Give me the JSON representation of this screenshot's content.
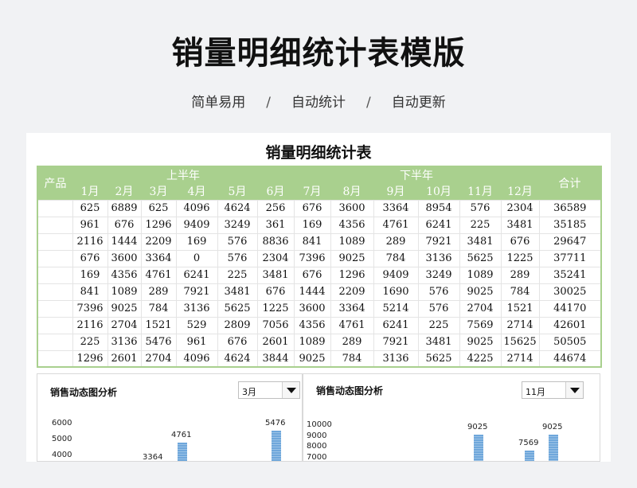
{
  "page": {
    "title": "销量明细统计表模版",
    "subtitle": [
      "简单易用",
      "自动统计",
      "自动更新"
    ],
    "separator": "/"
  },
  "sheet": {
    "title": "销量明细统计表",
    "header": {
      "product": "产品",
      "first_half": "上半年",
      "second_half": "下半年",
      "total": "合计",
      "months": [
        "1月",
        "2月",
        "3月",
        "4月",
        "5月",
        "6月",
        "7月",
        "8月",
        "9月",
        "10月",
        "11月",
        "12月"
      ]
    },
    "rows": [
      {
        "product": "",
        "values": [
          625,
          6889,
          625,
          4096,
          4624,
          256,
          676,
          3600,
          3364,
          8954,
          576,
          2304
        ],
        "total": 36589
      },
      {
        "product": "",
        "values": [
          961,
          676,
          1296,
          9409,
          3249,
          361,
          169,
          4356,
          4761,
          6241,
          225,
          3481
        ],
        "total": 35185
      },
      {
        "product": "",
        "values": [
          2116,
          1444,
          2209,
          169,
          576,
          8836,
          841,
          1089,
          289,
          7921,
          3481,
          676
        ],
        "total": 29647
      },
      {
        "product": "",
        "values": [
          676,
          3600,
          3364,
          0,
          576,
          2304,
          7396,
          9025,
          784,
          3136,
          5625,
          1225
        ],
        "total": 37711
      },
      {
        "product": "",
        "values": [
          169,
          4356,
          4761,
          6241,
          225,
          3481,
          676,
          1296,
          9409,
          3249,
          1089,
          289
        ],
        "total": 35241
      },
      {
        "product": "",
        "values": [
          841,
          1089,
          289,
          7921,
          3481,
          676,
          1444,
          2209,
          1690,
          576,
          9025,
          784
        ],
        "total": 30025
      },
      {
        "product": "",
        "values": [
          7396,
          9025,
          784,
          3136,
          5625,
          1225,
          3600,
          3364,
          5214,
          576,
          2704,
          1521
        ],
        "total": 44170
      },
      {
        "product": "",
        "values": [
          2116,
          2704,
          1521,
          529,
          2809,
          7056,
          4356,
          4761,
          6241,
          225,
          7569,
          2714
        ],
        "total": 42601
      },
      {
        "product": "",
        "values": [
          225,
          3136,
          5476,
          961,
          676,
          2601,
          1089,
          289,
          7921,
          3481,
          9025,
          15625
        ],
        "total": 50505
      },
      {
        "product": "",
        "values": [
          1296,
          2601,
          2704,
          4096,
          4624,
          3844,
          9025,
          784,
          3136,
          5625,
          4225,
          2714
        ],
        "total": 44674
      }
    ]
  },
  "charts": [
    {
      "title": "销售动态图分析",
      "selected": "3月",
      "chart_data": {
        "type": "bar",
        "yticks": [
          6000,
          5000,
          4000
        ],
        "ylim": [
          4000,
          6000
        ],
        "values": [
          3364,
          4761,
          5476
        ],
        "labels": [
          "3364",
          "4761",
          "5476"
        ]
      }
    },
    {
      "title": "销售动态图分析",
      "selected": "11月",
      "chart_data": {
        "type": "bar",
        "yticks": [
          10000,
          9000,
          8000,
          7000
        ],
        "ylim": [
          7000,
          10000
        ],
        "values": [
          9025,
          7569,
          9025
        ],
        "labels": [
          "9025",
          "7569",
          "9025"
        ]
      }
    }
  ]
}
